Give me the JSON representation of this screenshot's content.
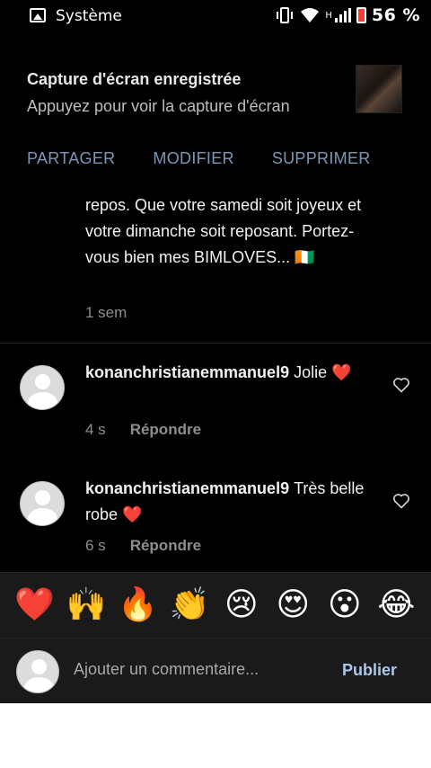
{
  "statusbar": {
    "app_name": "Système",
    "network_label": "H",
    "battery_percent": "56 %",
    "icons": [
      "image-icon",
      "vibrate-icon",
      "wifi-icon",
      "signal-icon",
      "battery-icon"
    ]
  },
  "notification": {
    "title": "Capture d'écran enregistrée",
    "subtitle": "Appuyez pour voir la capture d'écran",
    "actions": [
      "PARTAGER",
      "MODIFIER",
      "SUPPRIMER"
    ]
  },
  "caption": {
    "text": "repos. Que votre samedi soit joyeux et votre dimanche soit reposant. Portez-vous bien mes BIMLOVES... 🇨🇮",
    "time": "1 sem"
  },
  "comments": [
    {
      "user": "konanchristianemmanuel9",
      "text": "Jolie ❤️",
      "time": "4 s",
      "reply_label": "Répondre"
    },
    {
      "user": "konanchristianemmanuel9",
      "text": "Très belle robe ❤️",
      "time": "6 s",
      "reply_label": "Répondre"
    }
  ],
  "emoji_bar": [
    "❤️",
    "🙌",
    "🔥",
    "👏",
    "😢",
    "😍",
    "😮",
    "😂"
  ],
  "composer": {
    "placeholder": "Ajouter un commentaire...",
    "publish_label": "Publier"
  },
  "colors": {
    "background": "#000000",
    "panel": "#1a1a1a",
    "action_blue": "#7b97b5",
    "publish_blue": "#a9c8ea",
    "muted": "#8e8e8e"
  }
}
